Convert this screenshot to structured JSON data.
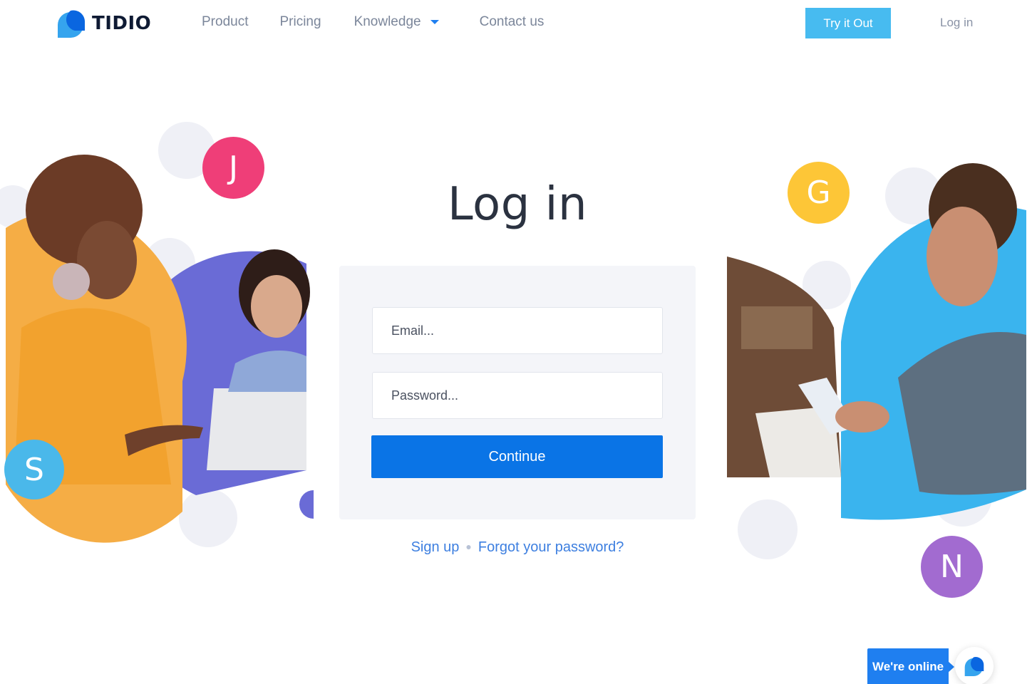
{
  "brand": {
    "name": "TIDIO"
  },
  "nav": {
    "items": [
      {
        "label": "Product"
      },
      {
        "label": "Pricing"
      },
      {
        "label": "Knowledge"
      },
      {
        "label": "Contact us"
      }
    ],
    "try_label": "Try it Out",
    "login_label": "Log in"
  },
  "login": {
    "title": "Log in",
    "email_placeholder": "Email...",
    "password_placeholder": "Password...",
    "continue_label": "Continue",
    "signup_label": "Sign up",
    "forgot_label": "Forgot your password?"
  },
  "badges": {
    "j": "J",
    "s": "S",
    "g": "G",
    "n": "N"
  },
  "chat": {
    "status_label": "We're online"
  },
  "colors": {
    "accent_blue": "#0a74e6",
    "try_button": "#47bbf0",
    "badge_j": "#ef3e78",
    "badge_s": "#4ab8ea",
    "badge_g": "#fdc637",
    "badge_n": "#a26bd0",
    "orange_circle": "#f5ad45",
    "purple_circle": "#6a6bd6",
    "blue_circle": "#3ab4ee"
  },
  "icons": [
    "tidio-logo-icon",
    "chevron-down-icon",
    "chat-logo-icon"
  ]
}
